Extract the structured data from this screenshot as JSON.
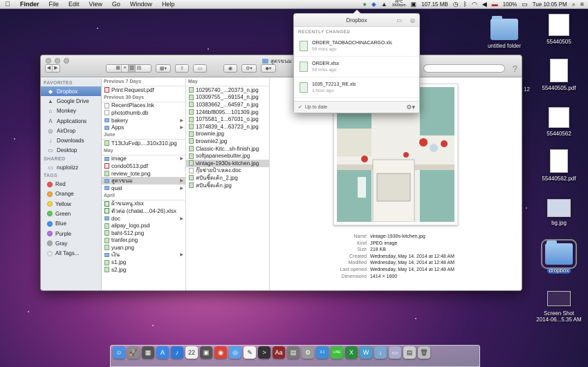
{
  "menubar": {
    "app": "Finder",
    "menus": [
      "File",
      "Edit",
      "View",
      "Go",
      "Window",
      "Help"
    ],
    "temp_top": "49°C",
    "temp_bottom": "3999rpm",
    "memory": "107.15 MB",
    "battery": "100%",
    "clock": "Tue 10:05 PM"
  },
  "finder": {
    "title": "สูตรขนม",
    "sidebar": {
      "favorites_label": "FAVORITES",
      "favorites": [
        {
          "label": "Dropbox",
          "icon": "dropbox-icon",
          "glyph": "◆"
        },
        {
          "label": "Google Drive",
          "icon": "google-drive-icon",
          "glyph": "▲"
        },
        {
          "label": "Monkey",
          "icon": "home-icon",
          "glyph": "⌂"
        },
        {
          "label": "Applications",
          "icon": "applications-icon",
          "glyph": "A"
        },
        {
          "label": "AirDrop",
          "icon": "airdrop-icon",
          "glyph": "◎"
        },
        {
          "label": "Downloads",
          "icon": "downloads-icon",
          "glyph": "↓"
        },
        {
          "label": "Desktop",
          "icon": "desktop-icon",
          "glyph": "▭"
        }
      ],
      "shared_label": "SHARED",
      "shared": [
        {
          "label": "nuploiizz",
          "icon": "computer-icon",
          "glyph": "▭"
        }
      ],
      "tags_label": "TAGS",
      "tags": [
        {
          "label": "Red",
          "color": "#f0544c"
        },
        {
          "label": "Orange",
          "color": "#f7a33a"
        },
        {
          "label": "Yellow",
          "color": "#f6d43a"
        },
        {
          "label": "Green",
          "color": "#5fc957"
        },
        {
          "label": "Blue",
          "color": "#3f93f0"
        },
        {
          "label": "Purple",
          "color": "#bd6de0"
        },
        {
          "label": "Gray",
          "color": "#a8a8a8"
        },
        {
          "label": "All Tags...",
          "color": "#e6e6e6"
        }
      ]
    },
    "col1": {
      "groups": [
        {
          "label": "Previous 7 Days",
          "items": [
            {
              "name": "Print Request.pdf",
              "type": "pdf"
            }
          ]
        },
        {
          "label": "Previous 30 Days",
          "items": [
            {
              "name": "RecentPlaces.lnk",
              "type": "doc"
            },
            {
              "name": "photothumb.db",
              "type": "doc"
            },
            {
              "name": "bakery",
              "type": "fold",
              "arrow": true
            },
            {
              "name": "Apps",
              "type": "fold",
              "arrow": true
            }
          ]
        },
        {
          "label": "June",
          "items": [
            {
              "name": "T13tJuFvdp....310x310.jpg",
              "type": "img"
            }
          ]
        },
        {
          "label": "May",
          "items": [
            {
              "name": "image",
              "type": "fold",
              "arrow": true
            },
            {
              "name": "condo0513.pdf",
              "type": "pdf"
            },
            {
              "name": "review_tote.png",
              "type": "img"
            },
            {
              "name": "สูตรขนม",
              "type": "fold",
              "arrow": true,
              "selected": true
            },
            {
              "name": "quat",
              "type": "fold",
              "arrow": true
            }
          ]
        },
        {
          "label": "April",
          "items": [
            {
              "name": "ผ้าขนหนู.xlsx",
              "type": "xls"
            },
            {
              "name": "ตัวต่อ (chalat....04-26).xlsx",
              "type": "xls"
            },
            {
              "name": "doc",
              "type": "fold",
              "arrow": true
            },
            {
              "name": "alipay_logo.psd",
              "type": "img"
            },
            {
              "name": "baht-512.png",
              "type": "img"
            },
            {
              "name": "tranfer.png",
              "type": "img"
            },
            {
              "name": "yuan.png",
              "type": "img"
            },
            {
              "name": "เงิน",
              "type": "fold",
              "arrow": true
            },
            {
              "name": "s1.jpg",
              "type": "img"
            },
            {
              "name": "s2.jpg",
              "type": "img"
            }
          ]
        }
      ]
    },
    "col2": {
      "groups": [
        {
          "label": "May",
          "items": [
            {
              "name": "10295740_...20373_n.jpg",
              "type": "img"
            },
            {
              "name": "10309755_...69154_n.jpg",
              "type": "img"
            },
            {
              "name": "10383662_...64597_n.jpg",
              "type": "img"
            },
            {
              "name": "1246bf8095....101309.jpg",
              "type": "img"
            },
            {
              "name": "1075581_1...67031_o.jpg",
              "type": "img"
            },
            {
              "name": "1374839_4...63723_n.jpg",
              "type": "img"
            },
            {
              "name": "brownie.jpg",
              "type": "img"
            },
            {
              "name": "brownie2.jpg",
              "type": "img"
            },
            {
              "name": "Classic-Kitc...sh-finish.jpg",
              "type": "img"
            },
            {
              "name": "softjapanesebutter.jpg",
              "type": "img"
            },
            {
              "name": "vintage-1930s-kitchen.jpg",
              "type": "img",
              "selected": true
            },
            {
              "name": "กุ๊ยช่ายป้าเหลง.doc",
              "type": "doc"
            },
            {
              "name": "สปันชิ้ดเค้ก_2.jpg",
              "type": "img"
            },
            {
              "name": "สปันชิ้ดเค้ก.jpg",
              "type": "img"
            }
          ]
        }
      ]
    },
    "preview": {
      "meta": [
        {
          "k": "Name",
          "v": "vintage-1930s-kitchen.jpg"
        },
        {
          "k": "Kind",
          "v": "JPEG image"
        },
        {
          "k": "Size",
          "v": "218 KB"
        },
        {
          "k": "Created",
          "v": "Wednesday, May 14, 2014 at 12:48 AM"
        },
        {
          "k": "Modified",
          "v": "Wednesday, May 14, 2014 at 12:48 AM"
        },
        {
          "k": "Last opened",
          "v": "Wednesday, May 14, 2014 at 12:48 AM"
        },
        {
          "k": "Dimensions",
          "v": "1414 × 1600"
        }
      ]
    }
  },
  "dropbox": {
    "title": "Dropbox",
    "section": "RECENTLY CHANGED",
    "items": [
      {
        "name": "ORDER_TAOBAOCHINACARGO.xls",
        "time": "59 mins ago"
      },
      {
        "name": "ORDER.xlsx",
        "time": "59 mins ago"
      },
      {
        "name": "1035_T2213_RE.xls",
        "time": "1 hour ago"
      }
    ],
    "status": "Up to date"
  },
  "desktop": {
    "icons": [
      {
        "label": "55440505",
        "kind": "doc"
      },
      {
        "label": "untitled folder",
        "kind": "folder"
      },
      {
        "label": "55440505.pdf",
        "kind": "pdf"
      },
      {
        "label": "55440562",
        "kind": "doc"
      },
      {
        "label": "55440562.pdf",
        "kind": "pdf"
      },
      {
        "label": "bg.jpg",
        "kind": "img"
      },
      {
        "label": "dropbox",
        "kind": "folder-selected"
      },
      {
        "label": "Screen Shot",
        "label2": "2014-06...5.35 AM",
        "kind": "shot"
      }
    ],
    "partial_label": "12"
  },
  "dock": {
    "apps": [
      {
        "name": "finder-dock-icon",
        "color": "#4b8fe0",
        "glyph": "☺"
      },
      {
        "name": "launchpad-dock-icon",
        "color": "#8a8a8a",
        "glyph": "🚀"
      },
      {
        "name": "mission-control-dock-icon",
        "color": "#555",
        "glyph": "▦"
      },
      {
        "name": "app-store-dock-icon",
        "color": "#3a86e6",
        "glyph": "A"
      },
      {
        "name": "itunes-dock-icon",
        "color": "#2f78d8",
        "glyph": "♪"
      },
      {
        "name": "calendar-dock-icon",
        "color": "#eeeeee",
        "glyph": "22"
      },
      {
        "name": "photo-dock-icon",
        "color": "#555",
        "glyph": "▣"
      },
      {
        "name": "chrome-dock-icon",
        "color": "#d9453a",
        "glyph": "◉"
      },
      {
        "name": "safari-dock-icon",
        "color": "#5aa0e8",
        "glyph": "◎"
      },
      {
        "name": "textedit-dock-icon",
        "color": "#f3f3f3",
        "glyph": "✎"
      },
      {
        "name": "terminal-dock-icon",
        "color": "#333",
        "glyph": ">"
      },
      {
        "name": "dictionary-dock-icon",
        "color": "#8b2a2a",
        "glyph": "Aa"
      },
      {
        "name": "preview-dock-icon",
        "color": "#777",
        "glyph": "▤"
      },
      {
        "name": "settings-dock-icon",
        "color": "#999",
        "glyph": "⚙"
      },
      {
        "name": "chat-dock-icon",
        "color": "#3b8ed8",
        "glyph": "3.1"
      },
      {
        "name": "line-dock-icon",
        "color": "#3fbf3f",
        "glyph": "LINE"
      },
      {
        "name": "excel-dock-icon",
        "color": "#2a8a3e",
        "glyph": "X"
      },
      {
        "name": "word-dock-icon",
        "color": "#4d9ccc",
        "glyph": "W"
      },
      {
        "name": "downloads-dock-icon",
        "color": "#7aa6cf",
        "glyph": "↓"
      },
      {
        "name": "documents-dock-icon",
        "color": "#aac",
        "glyph": "▭"
      },
      {
        "name": "stack-dock-icon",
        "color": "#ccc",
        "glyph": "▤"
      },
      {
        "name": "trash-dock-icon",
        "color": "#bbb",
        "glyph": "🗑"
      }
    ]
  }
}
